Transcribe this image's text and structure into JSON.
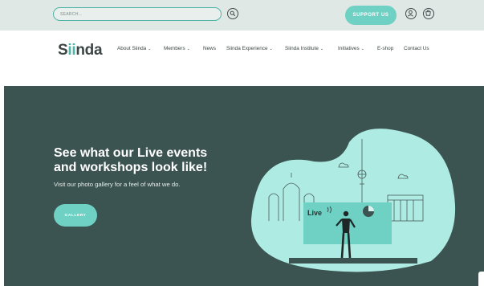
{
  "topbar": {
    "search_placeholder": "SEARCH...",
    "support_label": "SUPPORT US"
  },
  "brand": {
    "logo_start": "S",
    "logo_ii": "ii",
    "logo_end": "nda"
  },
  "menu": {
    "items": [
      {
        "label": "About Siinda",
        "has_dropdown": true
      },
      {
        "label": "Members",
        "has_dropdown": true
      },
      {
        "label": "News",
        "has_dropdown": false
      },
      {
        "label": "Siinda Experience",
        "has_dropdown": true
      },
      {
        "label": "Siinda Institute",
        "has_dropdown": true
      },
      {
        "label": "Initiatives",
        "has_dropdown": true
      },
      {
        "label": "E-shop",
        "has_dropdown": false
      },
      {
        "label": "Contact Us",
        "has_dropdown": false
      }
    ],
    "chevron": "⌄"
  },
  "hero": {
    "heading_line1": "See what our Live events",
    "heading_line2": "and workshops look like!",
    "subtext": "Visit our photo gallery for a feel of what we do.",
    "button_label": "GALLERY",
    "screen_text": "Live"
  },
  "colors": {
    "accent": "#6fd0c4",
    "hero_bg": "#3c5451",
    "topbar_bg": "#dfe8e4",
    "text_dark": "#3b4544"
  }
}
